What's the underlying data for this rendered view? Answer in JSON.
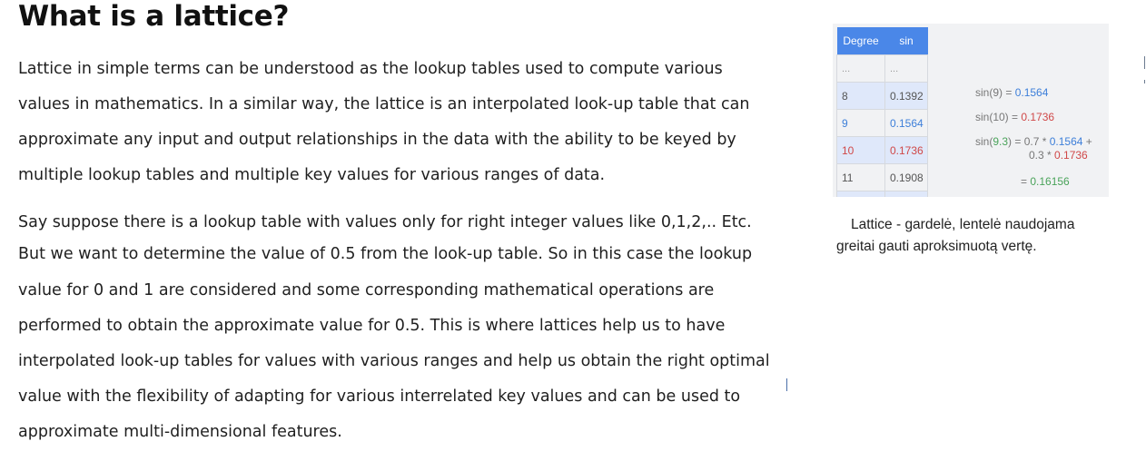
{
  "title": "What is a lattice?",
  "paragraph1": [
    "Lattice in simple terms can be understood as the lookup tables used to compute various",
    "values in mathematics. In a similar way, the lattice is an interpolated look-up table that can",
    "approximate any input and output relationships in the data with the ability to be keyed by",
    "multiple lookup tables and multiple key values for various ranges of data."
  ],
  "paragraph2": [
    "Say suppose there is a lookup table with values only for right integer values like 0,1,2,.. Etc.",
    "But we want to determine the value of 0.5 from the look-up table. So in this case the lookup",
    "value for 0 and 1 are considered and some corresponding mathematical operations are",
    "performed to obtain the approximate value for 0.5. This is where lattices help us to have",
    "interpolated look-up tables for values with various ranges and help us obtain the right optimal",
    "value with the flexibility of adapting for various interrelated key values and can be used to",
    "approximate multi-dimensional features."
  ],
  "lookup_table": {
    "headers": [
      "Degree",
      "sin"
    ],
    "ellipsis": [
      "...",
      "..."
    ],
    "rows": [
      [
        "8",
        "0.1392"
      ],
      [
        "9",
        "0.1564"
      ],
      [
        "10",
        "0.1736"
      ],
      [
        "11",
        "0.1908"
      ]
    ]
  },
  "formulas": {
    "f1_prefix": "sin(9) = ",
    "f1_value": "0.1564",
    "f2_prefix": "sin(10) = ",
    "f2_value": "0.1736",
    "f3_prefix": "sin(",
    "f3_arg": "9.3",
    "f3_mid": ") = 0.7 * ",
    "f3_v1": "0.1564",
    "f3_plus": " +",
    "f4_prefix": "0.3 * ",
    "f4_v2": "0.1736",
    "f5_prefix": "= ",
    "f5_result": "0.16156"
  },
  "caption": [
    "Lattice - gardelė, lentelė naudojama",
    "greitai gauti  aproksimuotą vertę."
  ]
}
